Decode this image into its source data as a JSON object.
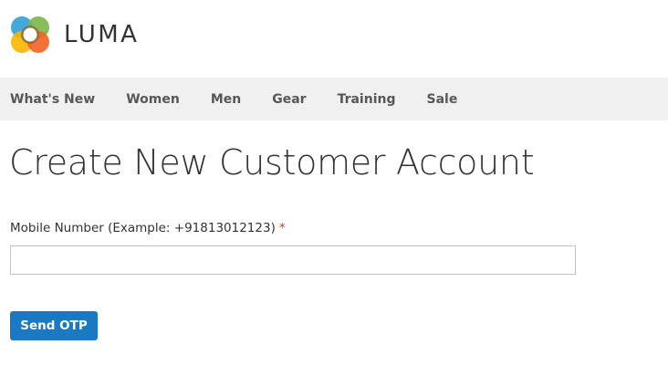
{
  "header": {
    "logo_text": "LUMA",
    "logo_icon": "luma-logo-icon",
    "logo_colors": [
      "#f26322",
      "#7ab648",
      "#f7b600",
      "#2d9fd9"
    ]
  },
  "nav": {
    "items": [
      {
        "label": "What's New"
      },
      {
        "label": "Women"
      },
      {
        "label": "Men"
      },
      {
        "label": "Gear"
      },
      {
        "label": "Training"
      },
      {
        "label": "Sale"
      }
    ]
  },
  "main": {
    "title": "Create New Customer Account",
    "mobile_field": {
      "label": "Mobile Number (Example: +91813012123)",
      "required_marker": "*",
      "value": "",
      "placeholder": ""
    },
    "send_otp_label": "Send OTP"
  },
  "colors": {
    "primary_button": "#1979c3",
    "nav_background": "#f0f0f0",
    "required": "#e02b27"
  }
}
